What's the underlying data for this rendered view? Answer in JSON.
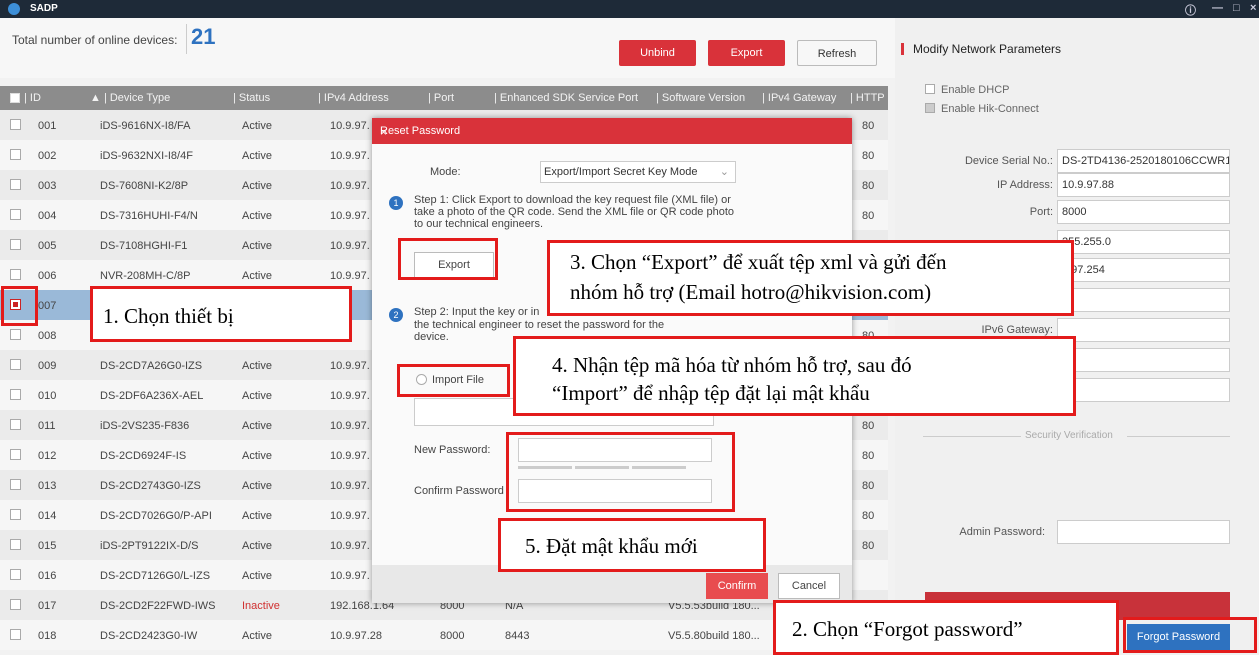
{
  "app": {
    "title": "SADP"
  },
  "toolbar": {
    "total_label": "Total number of online devices:",
    "total_count": "21",
    "unbind": "Unbind",
    "export": "Export",
    "refresh": "Refresh"
  },
  "table": {
    "headers": {
      "id": "| ID",
      "device_type": "▲ | Device Type",
      "status": "| Status",
      "ipv4": "| IPv4 Address",
      "port": "| Port",
      "sdk": "| Enhanced SDK Service Port",
      "sw": "| Software Version",
      "gw": "| IPv4 Gateway",
      "http": "| HTTP"
    },
    "rows": [
      {
        "id": "001",
        "type": "iDS-9616NX-I8/FA",
        "status": "Active",
        "ip": "10.9.97."
      },
      {
        "id": "002",
        "type": "iDS-9632NXI-I8/4F",
        "status": "Active",
        "ip": "10.9.97."
      },
      {
        "id": "003",
        "type": "DS-7608NI-K2/8P",
        "status": "Active",
        "ip": "10.9.97."
      },
      {
        "id": "004",
        "type": "DS-7316HUHI-F4/N",
        "status": "Active",
        "ip": "10.9.97."
      },
      {
        "id": "005",
        "type": "DS-7108HGHI-F1",
        "status": "Active",
        "ip": "10.9.97."
      },
      {
        "id": "006",
        "type": "NVR-208MH-C/8P",
        "status": "Active",
        "ip": "10.9.97."
      },
      {
        "id": "007",
        "type": "",
        "status": "",
        "ip": "97."
      },
      {
        "id": "008",
        "type": "",
        "status": "",
        "ip": "97."
      },
      {
        "id": "009",
        "type": "DS-2CD7A26G0-IZS",
        "status": "Active",
        "ip": "10.9.97."
      },
      {
        "id": "010",
        "type": "DS-2DF6A236X-AEL",
        "status": "Active",
        "ip": "10.9.97."
      },
      {
        "id": "011",
        "type": "iDS-2VS235-F836",
        "status": "Active",
        "ip": "10.9.97."
      },
      {
        "id": "012",
        "type": "DS-2CD6924F-IS",
        "status": "Active",
        "ip": "10.9.97."
      },
      {
        "id": "013",
        "type": "DS-2CD2743G0-IZS",
        "status": "Active",
        "ip": "10.9.97."
      },
      {
        "id": "014",
        "type": "DS-2CD7026G0/P-API",
        "status": "Active",
        "ip": "10.9.97."
      },
      {
        "id": "015",
        "type": "iDS-2PT9122IX-D/S",
        "status": "Active",
        "ip": "10.9.97."
      },
      {
        "id": "016",
        "type": "DS-2CD7126G0/L-IZS",
        "status": "Active",
        "ip": "10.9.97."
      },
      {
        "id": "017",
        "type": "DS-2CD2F22FWD-IWS",
        "status": "Inactive",
        "ip": "192.168.1.64",
        "port": "8000",
        "sdk": "N/A",
        "sw": "V5.5.53build 180..."
      },
      {
        "id": "018",
        "type": "DS-2CD2423G0-IW",
        "status": "Active",
        "ip": "10.9.97.28",
        "port": "8000",
        "sdk": "8443",
        "sw": "V5.5.80build 180..."
      }
    ],
    "http_values": [
      "80",
      "80",
      "80",
      "80",
      "80",
      "80",
      "80",
      "80",
      "80",
      "80",
      "80",
      "80",
      "80",
      "80",
      "80"
    ]
  },
  "modal": {
    "title": "Reset Password",
    "close": "×",
    "mode_label": "Mode:",
    "mode_value": "Export/Import Secret Key Mode",
    "step1_num": "1",
    "step1_text": "Step 1: Click Export to download the key request file (XML file) or take a photo of the QR code. Send the XML file or QR code photo to our technical engineers.",
    "export_btn": "Export",
    "step2_num": "2",
    "step2_text_a": "Step 2: Input the key or in",
    "step2_text_b": "the technical engineer to reset the password for the device.",
    "import_label": "Import File",
    "new_password_label": "New Password:",
    "confirm_password_label": "Confirm Password",
    "confirm_btn": "Confirm",
    "cancel_btn": "Cancel"
  },
  "right_panel": {
    "title": "Modify Network Parameters",
    "enable_dhcp": "Enable DHCP",
    "enable_hik": "Enable Hik-Connect",
    "serial_label": "Device Serial No.:",
    "serial_value": "DS-2TD4136-2520180106CCWR16",
    "ip_label": "IP Address:",
    "ip_value": "10.9.97.88",
    "port_label": "Port:",
    "port_value": "8000",
    "mask_value": "255.255.0",
    "gw_value": "9.97.254",
    "ipv6gw_label": "IPv6 Gateway:",
    "security_label": "Security Verification",
    "admin_label": "Admin Password:",
    "forgot_btn": "Forgot Password"
  },
  "callouts": {
    "c1": "1. Chọn thiết bị",
    "c2": "2. Chọn “Forgot password”",
    "c3a": "3. Chọn “Export” để xuất tệp xml và gửi đến",
    "c3b": "nhóm hỗ trợ (Email hotro@hikvision.com)",
    "c4a": "4. Nhận tệp mã hóa từ nhóm hỗ trợ, sau đó",
    "c4b": "“Import” để nhập tệp đặt lại mật khẩu",
    "c5": "5. Đặt mật khẩu mới"
  },
  "colors": {
    "accent_red": "#d9323a",
    "accent_blue": "#2e72c0",
    "callout_red": "#e31b1b"
  }
}
